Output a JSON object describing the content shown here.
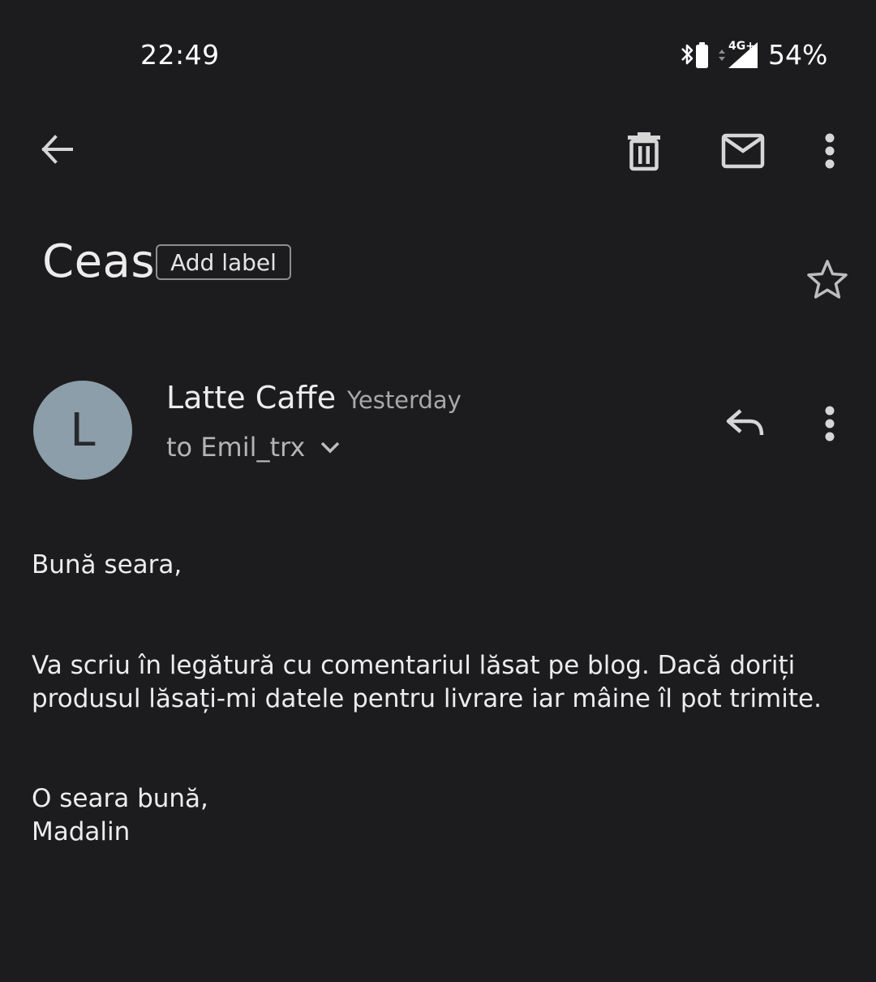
{
  "status_bar": {
    "time": "22:49",
    "network": "4G+",
    "battery": "54%",
    "icons": [
      "bluetooth-icon",
      "battery-icon",
      "data-arrows-icon",
      "signal-icon"
    ]
  },
  "toolbar": {
    "icons": [
      "back-arrow-icon",
      "trash-icon",
      "mail-icon",
      "more-vert-icon"
    ]
  },
  "subject": {
    "title": "Ceas",
    "add_label": "Add label",
    "star_icon": "star-outline-icon"
  },
  "message": {
    "avatar_letter": "L",
    "sender": "Latte Caffe",
    "date": "Yesterday",
    "recipient": "to Emil_trx",
    "icons": [
      "chevron-down-icon",
      "reply-icon",
      "more-vert-icon"
    ],
    "body": {
      "greeting": "Bună seara,",
      "line1": "Va scriu în legătură cu comentariul lăsat pe blog. Dacă doriți",
      "line2": "produsul lăsați-mi datele pentru livrare iar mâine îl pot trimite.",
      "closing": "O seara bună,",
      "signature": "Madalin"
    }
  },
  "colors": {
    "background": "#1c1c1e",
    "avatar": "#8b9ea9",
    "text": "#ececec",
    "muted": "#a8a8a8"
  }
}
